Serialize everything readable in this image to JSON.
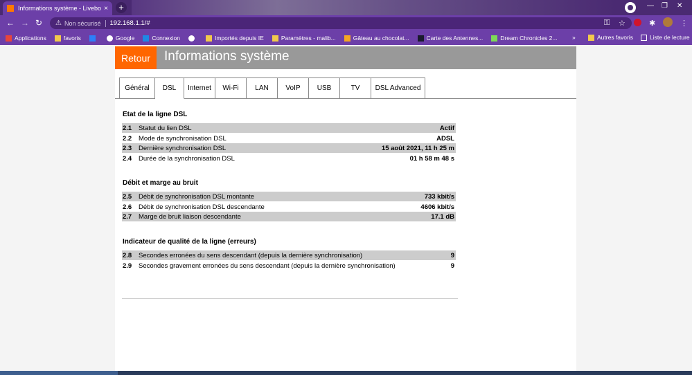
{
  "browser": {
    "tab_title": "Informations système - Livebox C",
    "tab_close": "×",
    "new_tab": "+",
    "security_label": "Non sécurisé",
    "url": "192.168.1.1/#",
    "bookmarks": [
      {
        "label": "Applications",
        "color": "#e8453c"
      },
      {
        "label": "favoris",
        "color": "#f2c94c"
      },
      {
        "label": "",
        "color": "#2d7ff9"
      },
      {
        "label": "Google",
        "color": "#ffffff"
      },
      {
        "label": "Connexion",
        "color": "#1e88e5"
      },
      {
        "label": "",
        "color": "#ffffff"
      },
      {
        "label": "Importés depuis IE",
        "color": "#f2c94c"
      },
      {
        "label": "Paramètres - malib...",
        "color": "#f2c94c"
      },
      {
        "label": "Gâteau au chocolat...",
        "color": "#f5a623"
      },
      {
        "label": "Carte des Antennes...",
        "color": "#1a1a2e"
      },
      {
        "label": "Dream Chronicles 2...",
        "color": "#7ed957"
      }
    ],
    "more_bookmarks": "»",
    "other_favorites": "Autres favoris",
    "reading_list": "Liste de lecture"
  },
  "page": {
    "back_button": "Retour",
    "title": "Informations système",
    "tabs": [
      {
        "label": "Général"
      },
      {
        "label": "DSL"
      },
      {
        "label": "Internet"
      },
      {
        "label": "Wi-Fi"
      },
      {
        "label": "LAN"
      },
      {
        "label": "VoIP"
      },
      {
        "label": "USB"
      },
      {
        "label": "TV"
      },
      {
        "label": "DSL Advanced"
      }
    ],
    "active_tab": "DSL",
    "sections": [
      {
        "title": "Etat de la ligne DSL",
        "rows": [
          {
            "num": "2.1",
            "label": "Statut du lien DSL",
            "value": "Actif"
          },
          {
            "num": "2.2",
            "label": "Mode de synchronisation DSL",
            "value": "ADSL"
          },
          {
            "num": "2.3",
            "label": "Dernière synchronisation DSL",
            "value": "15 août 2021, 11 h 25 m"
          },
          {
            "num": "2.4",
            "label": "Durée de la synchronisation DSL",
            "value": "01 h 58 m 48 s"
          }
        ]
      },
      {
        "title": "Débit et marge au bruit",
        "rows": [
          {
            "num": "2.5",
            "label": "Débit de synchronisation DSL montante",
            "value": "733 kbit/s"
          },
          {
            "num": "2.6",
            "label": "Débit de synchronisation DSL descendante",
            "value": "4606 kbit/s"
          },
          {
            "num": "2.7",
            "label": "Marge de bruit liaison descendante",
            "value": "17.1 dB"
          }
        ]
      },
      {
        "title": "Indicateur de qualité de la ligne (erreurs)",
        "rows": [
          {
            "num": "2.8",
            "label": "Secondes erronées du sens descendant (depuis la dernière synchronisation)",
            "value": "9"
          },
          {
            "num": "2.9",
            "label": "Secondes gravement erronées du sens descendant (depuis la dernière synchronisation)",
            "value": "9"
          }
        ]
      }
    ]
  },
  "colors": {
    "orange": "#ff6600",
    "header_gray": "#999999",
    "row_shade": "#cccccc",
    "browser_purple": "#6c3fa8"
  }
}
